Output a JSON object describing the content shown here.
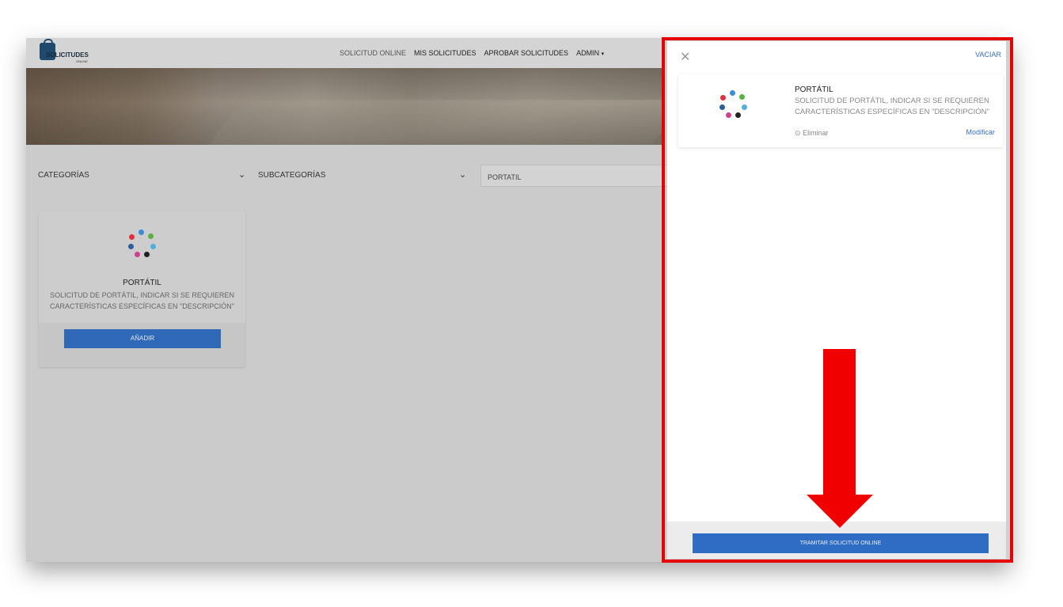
{
  "app": {
    "logo_text": "SOLICITUDES",
    "logo_sub": "ONLINE"
  },
  "nav": {
    "items": [
      {
        "label": "SOLICITUD ONLINE"
      },
      {
        "label": "MIS SOLICITUDES"
      },
      {
        "label": "APROBAR SOLICITUDES"
      },
      {
        "label": "ADMIN"
      }
    ]
  },
  "filters": {
    "categories_label": "CATEGORÍAS",
    "subcategories_label": "SUBCATEGORÍAS",
    "search_value": "PORTATIL"
  },
  "product": {
    "title": "PORTÁTIL",
    "description": "SOLICITUD DE PORTÁTIL, INDICAR SI SE REQUIEREN CARACTERÍSTICAS ESPECÍFICAS EN \"DESCRIPCIÓN\"",
    "add_label": "AÑADIR"
  },
  "cart": {
    "clear_label": "VACIAR",
    "item_title": "PORTÁTIL",
    "item_description": "SOLICITUD DE PORTÁTIL, INDICAR SI SE REQUIEREN CARACTERÍSTICAS ESPECÍFICAS EN \"DESCRIPCIÓN\"",
    "remove_label": "Eliminar",
    "edit_label": "Modificar",
    "submit_label": "TRAMITAR SOLICITUD ONLINE"
  },
  "icons": {
    "close": "close-icon",
    "chevron": "chevron-down-icon",
    "remove": "remove-circle-icon",
    "caret": "caret-down-icon"
  },
  "colors": {
    "primary_button": "#2f69b8",
    "link": "#3a70c8",
    "highlight": "#e60000"
  }
}
